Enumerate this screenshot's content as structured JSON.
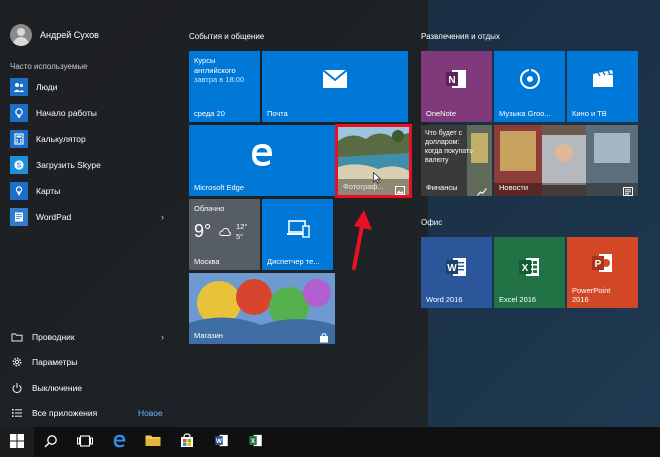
{
  "user": {
    "name": "Андрей Сухов"
  },
  "frequent_label": "Часто используемые",
  "apps": [
    {
      "label": "Люди",
      "icon": "people-icon",
      "color": "#1b6fc8",
      "arrow": ""
    },
    {
      "label": "Начало работы",
      "icon": "lightbulb-icon",
      "color": "#1b6fc8",
      "arrow": ""
    },
    {
      "label": "Калькулятор",
      "icon": "calculator-icon",
      "color": "#1b6fc8",
      "arrow": ""
    },
    {
      "label": "Загрузить Skype",
      "icon": "skype-icon",
      "color": "#1e8fd8",
      "arrow": ""
    },
    {
      "label": "Карты",
      "icon": "maps-icon",
      "color": "#1b6fc8",
      "arrow": ""
    },
    {
      "label": "WordPad",
      "icon": "wordpad-icon",
      "color": "#2f7dd1",
      "arrow": "›"
    }
  ],
  "bottom": {
    "explorer": {
      "label": "Проводник",
      "arrow": "›"
    },
    "settings": {
      "label": "Параметры"
    },
    "power": {
      "label": "Выключение"
    },
    "all_apps": {
      "label": "Все приложения",
      "badge": "Новое"
    }
  },
  "groups": {
    "events": "События и общение",
    "entertainment": "Развлечения и отдых",
    "office": "Офис"
  },
  "tiles": {
    "calendar": {
      "line1": "Курсы",
      "line2": "английского",
      "line3": "завтра в 18:00",
      "day": "среда 20"
    },
    "mail": {
      "label": "Почта"
    },
    "edge": {
      "label": "Microsoft Edge"
    },
    "photos": {
      "label": "Фотограф..."
    },
    "weather": {
      "title": "Облачно",
      "temp": "9°",
      "hi": "12°",
      "lo": "5°",
      "city": "Москва"
    },
    "devmgr": {
      "label": "Диспетчер те..."
    },
    "store": {
      "label": "Магазин"
    },
    "onenote": {
      "label": "OneNote"
    },
    "groove": {
      "label": "Музыка Groo..."
    },
    "movies": {
      "label": "Кино и ТВ"
    },
    "finance": {
      "headline": "Что будет с долларом: когда покупать валюту",
      "label": "Финансы"
    },
    "news": {
      "label": "Новости"
    },
    "word": {
      "label": "Word 2016"
    },
    "excel": {
      "label": "Excel 2016"
    },
    "ppt": {
      "line1": "PowerPoint",
      "line2": "2016"
    }
  },
  "colors": {
    "accent": "#0078d7",
    "onenote": "#80397b",
    "word": "#2b579a",
    "excel": "#217346",
    "powerpoint": "#d24726",
    "highlight": "#e81123"
  }
}
